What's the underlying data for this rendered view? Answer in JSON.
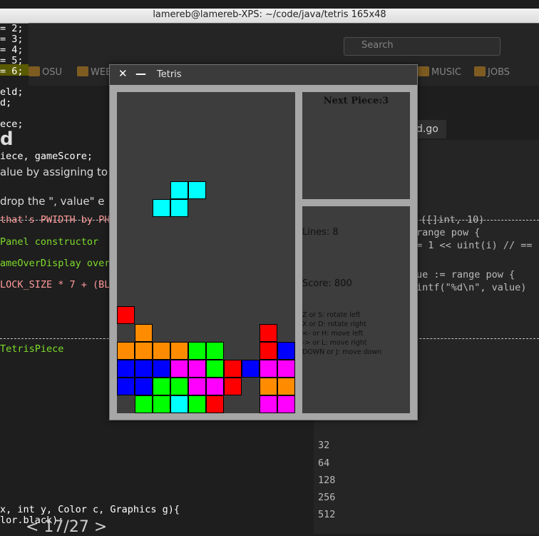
{
  "terminal": {
    "title": "lamereb@lamereb-XPS: ~/code/java/tetris 165x48",
    "code_lines": [
      {
        "text": "= 2;",
        "color": "#ffffff"
      },
      {
        "text": "= 3;",
        "color": "#ffffff"
      },
      {
        "text": "= 4;",
        "color": "#ffffff"
      },
      {
        "text": "= 5;",
        "color": "#ffffff"
      },
      {
        "text": "= 6;",
        "color": "#ffffff"
      },
      {
        "text": "eld;",
        "color": "#ffffff"
      },
      {
        "text": "d;",
        "color": "#ffffff"
      },
      {
        "text": "ece;",
        "color": "#ffffff"
      },
      {
        "text": "iece, gameScore;",
        "color": "#ffffff"
      },
      {
        "text": "that's PWIDTH by PH",
        "color": "#ff9a9a"
      },
      {
        "text": "Panel constructor",
        "color": "#7fdc2a"
      },
      {
        "text": "ameOverDisplay overl",
        "color": "#7fdc2a"
      },
      {
        "text": "LOCK_SIZE * 7 + (BLO",
        "color": "#ff9a9a"
      },
      {
        "text": "TetrisPiece",
        "color": "#7fdc2a"
      },
      {
        "text": "x, int y, Color c, Graphics g){",
        "color": "#ffffff"
      },
      {
        "text": "lor.black);",
        "color": "#ffffff"
      }
    ],
    "prose_lines": [
      "alue by assigning to",
      "drop the \", value\" e"
    ],
    "big_heading": "d",
    "right_code_lines": [
      "([]int, 10)",
      "range pow {",
      "= 1 << uint(i) // ==",
      "ue := range pow {",
      "intf(\"%d\\n\", value)"
    ],
    "right_numbers": [
      "32",
      "64",
      "128",
      "256",
      "512"
    ],
    "go_tab": "d.go",
    "pager": "< 17/27 >",
    "search_placeholder": "Search",
    "bookmarks": [
      "OSU",
      "WEB",
      "MUSIC",
      "JOBS"
    ]
  },
  "tetris": {
    "window_title": "Tetris",
    "close_glyph": "✕",
    "minimize_glyph": "—",
    "next_piece_label": "Next Piece:3",
    "lines_label": "Lines:  8",
    "score_label": "Score:  800",
    "help": [
      "Z or S: rotate left",
      "X or D: rotate right",
      "<- or H: move left",
      "-> or L: move right",
      "DOWN or J: move down"
    ],
    "colors": {
      "O": "#ff8c00",
      "B": "#0000ff",
      "M": "#ff00ff",
      "G": "#00ff00",
      "R": "#ff0000",
      "C": "#00ffff"
    },
    "board_rows": [
      "..........",
      "..........",
      "..........",
      "..........",
      "..........",
      "..........",
      "...CC.....",
      "..CC......",
      "..........",
      "..........",
      "..........",
      "..........",
      "..........",
      "R.........",
      ".O......R.",
      "OOOOGG..RBB",
      "BBBMMGRBMM",
      "BBGGMMR.OO",
      ".GGCGR..MM"
    ]
  }
}
